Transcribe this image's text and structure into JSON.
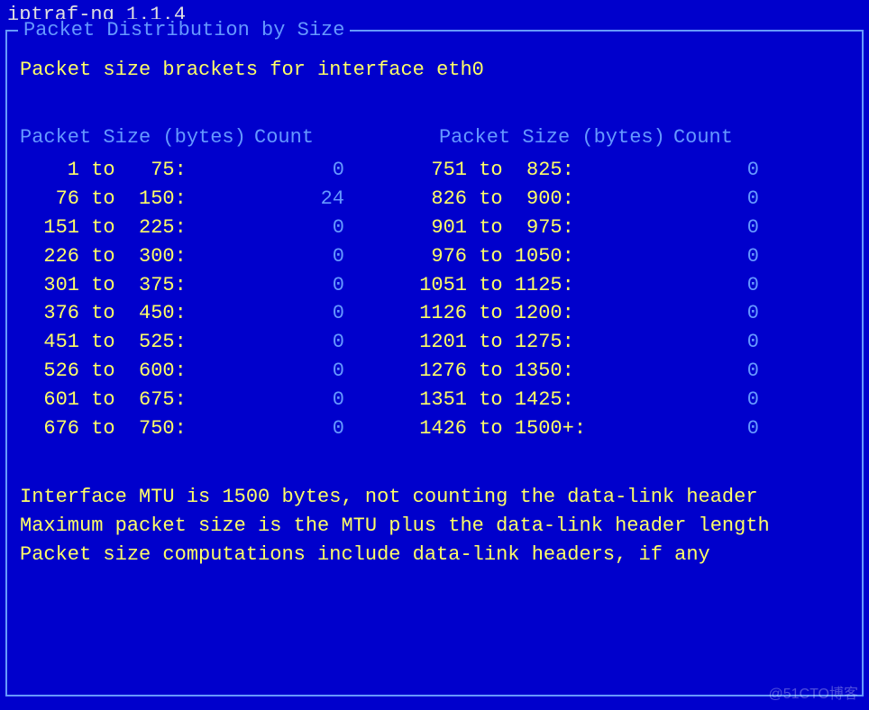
{
  "app_title": "iptraf-ng 1.1.4",
  "frame_title": " Packet Distribution by Size ",
  "subtitle": "Packet size brackets for interface eth0",
  "headers": {
    "size": "Packet Size (bytes)",
    "count": "Count"
  },
  "left_brackets": [
    {
      "range": "    1 to   75:",
      "count": "0"
    },
    {
      "range": "   76 to  150:",
      "count": "24"
    },
    {
      "range": "  151 to  225:",
      "count": "0"
    },
    {
      "range": "  226 to  300:",
      "count": "0"
    },
    {
      "range": "  301 to  375:",
      "count": "0"
    },
    {
      "range": "  376 to  450:",
      "count": "0"
    },
    {
      "range": "  451 to  525:",
      "count": "0"
    },
    {
      "range": "  526 to  600:",
      "count": "0"
    },
    {
      "range": "  601 to  675:",
      "count": "0"
    },
    {
      "range": "  676 to  750:",
      "count": "0"
    }
  ],
  "right_brackets": [
    {
      "range": "  751 to  825:",
      "count": "0"
    },
    {
      "range": "  826 to  900:",
      "count": "0"
    },
    {
      "range": "  901 to  975:",
      "count": "0"
    },
    {
      "range": "  976 to 1050:",
      "count": "0"
    },
    {
      "range": " 1051 to 1125:",
      "count": "0"
    },
    {
      "range": " 1126 to 1200:",
      "count": "0"
    },
    {
      "range": " 1201 to 1275:",
      "count": "0"
    },
    {
      "range": " 1276 to 1350:",
      "count": "0"
    },
    {
      "range": " 1351 to 1425:",
      "count": "0"
    },
    {
      "range": " 1426 to 1500+:",
      "count": "0"
    }
  ],
  "footer": {
    "line1": "Interface MTU is 1500 bytes, not counting the data-link header",
    "line2": "Maximum packet size is the MTU plus the data-link header length",
    "line3": "Packet size computations include data-link headers, if any"
  },
  "watermark": "@51CTO博客"
}
